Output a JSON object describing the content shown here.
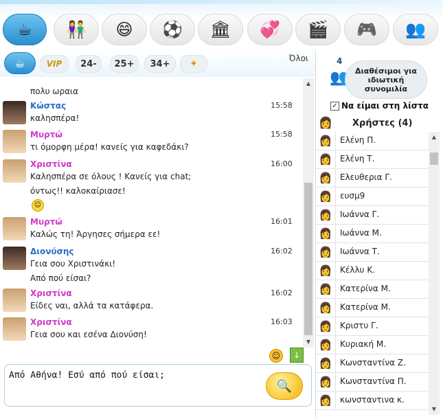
{
  "categories": [
    {
      "icon": "coffee-icon",
      "glyph": "☕"
    },
    {
      "icon": "couple-icon",
      "glyph": "👫"
    },
    {
      "icon": "smiley-icon",
      "glyph": "😄"
    },
    {
      "icon": "soccer-ball-icon",
      "glyph": "⚽"
    },
    {
      "icon": "bank-icon",
      "glyph": "🏛"
    },
    {
      "icon": "hearts-icon",
      "glyph": "💞"
    },
    {
      "icon": "film-icon",
      "glyph": "🎬"
    },
    {
      "icon": "gamepad-icon",
      "glyph": "🎮"
    },
    {
      "icon": "people-network-icon",
      "glyph": "👥"
    }
  ],
  "rooms": [
    "VIP",
    "24-",
    "25+",
    "34+"
  ],
  "audience": "Όλοι",
  "messages": [
    {
      "name": "",
      "time": "",
      "lines": [
        "πολυ ωραια"
      ]
    },
    {
      "name": "Κώστας",
      "gender": "m",
      "time": "15:58",
      "lines": [
        "καλησπέρα!"
      ]
    },
    {
      "name": "Μυρτώ",
      "gender": "f",
      "time": "15:58",
      "lines": [
        "τι όμορφη μέρα! κανείς για καφεδάκι?"
      ]
    },
    {
      "name": "Χριστίνα",
      "gender": "f",
      "time": "16:00",
      "lines": [
        "Καλησπέρα σε όλους ! Κανείς για chat;",
        "όντως!! καλοκαίριασε!"
      ]
    },
    {
      "name": "Μυρτώ",
      "gender": "f",
      "time": "16:01",
      "lines": [
        "Καλώς τη! Άργησες σήμερα εε!"
      ]
    },
    {
      "name": "Διονύσης",
      "gender": "m",
      "time": "16:02",
      "lines": [
        "Γεια σου Χριστινάκι!",
        "Από πού είσαι?"
      ]
    },
    {
      "name": "Χριστίνα",
      "gender": "f",
      "time": "16:02",
      "lines": [
        "Είδες ναι, αλλά τα κατάφερα."
      ]
    },
    {
      "name": "Χριστίνα",
      "gender": "f",
      "time": "16:03",
      "lines": [
        "Γεια σου και εσένα Διονύση!"
      ]
    }
  ],
  "colors": {
    "male": "#2b6cc9",
    "female": "#d236c9",
    "accent": "#2a8fd0"
  },
  "input": {
    "value": "Από Αθήνα! Εσύ από πού είσαι;"
  },
  "private_chat": {
    "count": "4",
    "label": "Διαθέσιμοι για ιδιωτική συνομιλία"
  },
  "in_list_label": "Να είμαι στη λίστα",
  "in_list_checked": true,
  "users_header": "Χρήστες (4)",
  "users": [
    "Ελένη Π.",
    "Ελένη Τ.",
    "Ελευθερια Γ.",
    "ευσμ9",
    "Ιωάννα Γ.",
    "Ιωάννα Μ.",
    "Ιωάννα Τ.",
    "Κέλλυ Κ.",
    "Κατερίνα Μ.",
    "Κατερίνα Μ.",
    "Κριστυ Γ.",
    "Κυριακή Μ.",
    "Κωνσταντίνα Ζ.",
    "Κωνσταντίνα Π.",
    "κωνσταντινα κ."
  ]
}
